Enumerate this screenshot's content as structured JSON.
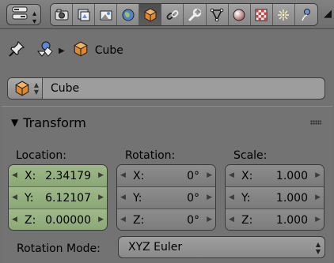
{
  "header": {
    "editor_type_icon": "properties-editor-icon",
    "context_tabs": [
      {
        "icon": "render-icon",
        "active": false
      },
      {
        "icon": "render-layers-icon",
        "active": false
      },
      {
        "icon": "scene-icon",
        "active": false
      },
      {
        "icon": "world-icon",
        "active": false
      },
      {
        "icon": "object-cube-icon",
        "active": true
      },
      {
        "icon": "constraints-icon",
        "active": false
      },
      {
        "icon": "modifiers-wrench-icon",
        "active": false
      },
      {
        "icon": "object-data-mesh-icon",
        "active": false
      },
      {
        "icon": "material-icon",
        "active": false
      },
      {
        "icon": "texture-icon",
        "active": false
      },
      {
        "icon": "particles-icon",
        "active": false
      },
      {
        "icon": "physics-icon",
        "active": false
      }
    ]
  },
  "path": {
    "object_name": "Cube"
  },
  "object_field": {
    "name": "Cube"
  },
  "transform": {
    "title": "Transform",
    "location": {
      "label": "Location:",
      "fields": [
        {
          "axis": "X:",
          "value": "2.34179"
        },
        {
          "axis": "Y:",
          "value": "6.12107"
        },
        {
          "axis": "Z:",
          "value": "0.00000"
        }
      ]
    },
    "rotation": {
      "label": "Rotation:",
      "fields": [
        {
          "axis": "X:",
          "value": "0°"
        },
        {
          "axis": "Y:",
          "value": "0°"
        },
        {
          "axis": "Z:",
          "value": "0°"
        }
      ]
    },
    "scale": {
      "label": "Scale:",
      "fields": [
        {
          "axis": "X:",
          "value": "1.000"
        },
        {
          "axis": "Y:",
          "value": "1.000"
        },
        {
          "axis": "Z:",
          "value": "1.000"
        }
      ]
    },
    "rotation_mode": {
      "label": "Rotation Mode:",
      "value": "XYZ Euler"
    }
  },
  "colors": {
    "background": "#727272",
    "location_fields": "#94b07f",
    "cube_orange": "#e0882e"
  }
}
